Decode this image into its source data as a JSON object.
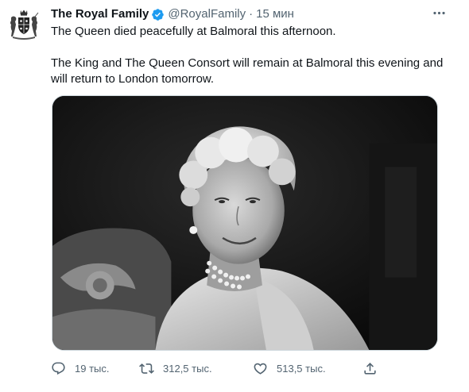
{
  "tweet": {
    "author": {
      "display_name": "The Royal Family",
      "handle": "@RoyalFamily",
      "verified": true,
      "avatar_icon": "royal-coat-of-arms-icon"
    },
    "separator": "·",
    "time": "15 мин",
    "text": {
      "line1": "The Queen died peacefully at Balmoral this afternoon.",
      "line2": "The King and The Queen Consort will remain at Balmoral this evening and will return to London tomorrow."
    },
    "media": {
      "type": "photo",
      "style": "black-and-white portrait"
    },
    "actions": {
      "reply": {
        "icon": "reply-icon",
        "count": "19 тыс."
      },
      "retweet": {
        "icon": "retweet-icon",
        "count": "312,5 тыс."
      },
      "like": {
        "icon": "heart-icon",
        "count": "513,5 тыс."
      },
      "share": {
        "icon": "share-icon"
      }
    },
    "more_icon": "more-options-icon"
  },
  "colors": {
    "text_primary": "#0f1419",
    "text_secondary": "#536471",
    "verified_blue": "#1d9bf0",
    "border": "#cfd9de"
  }
}
